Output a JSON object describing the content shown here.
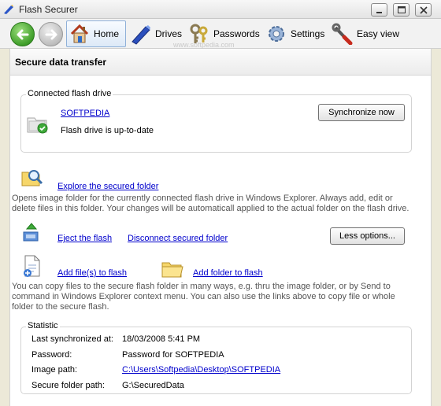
{
  "window": {
    "title": "Flash Securer"
  },
  "toolbar": {
    "items": [
      {
        "label": "Home",
        "icon": "home-icon"
      },
      {
        "label": "Drives",
        "icon": "pen-drive-icon"
      },
      {
        "label": "Passwords",
        "icon": "keys-icon"
      },
      {
        "label": "Settings",
        "icon": "gear-icon"
      },
      {
        "label": "Easy view",
        "icon": "wrench-icon"
      }
    ],
    "watermark": "www.softpedia.com"
  },
  "section_title": "Secure data transfer",
  "connected": {
    "legend": "Connected flash drive",
    "drive_name": "SOFTPEDIA",
    "status": "Flash drive is up-to-date",
    "sync_button": "Synchronize now"
  },
  "explore": {
    "link": "Explore the secured folder",
    "description": "Opens image folder for the currently connected flash drive in Windows Explorer. Always add, edit or delete files in this folder. Your changes will be automaticall applied to the actual folder on the flash drive."
  },
  "eject": {
    "eject_link": "Eject the flash",
    "disconnect_link": "Disconnect secured folder",
    "less_options_button": "Less options..."
  },
  "add": {
    "add_files_link": "Add file(s) to flash",
    "add_folder_link": "Add folder to flash",
    "description": "You can copy files to the secure flash folder in many ways, e.g. thru the image folder, or by Send to command in Windows Explorer context menu. You can also use the links above to copy file or whole folder to the secure flash."
  },
  "statistic": {
    "legend": "Statistic",
    "rows": [
      {
        "label": "Last synchronized at:",
        "value": "18/03/2008 5:41 PM"
      },
      {
        "label": "Password:",
        "value": "Password for SOFTPEDIA"
      },
      {
        "label": "Image path:",
        "value": "C:\\Users\\Softpedia\\Desktop\\SOFTPEDIA"
      },
      {
        "label": "Secure folder path:",
        "value": "G:\\SecuredData"
      }
    ]
  },
  "colors": {
    "link": "#0000cc",
    "accent_green": "#3f9e2a",
    "background": "#ece9d8"
  }
}
